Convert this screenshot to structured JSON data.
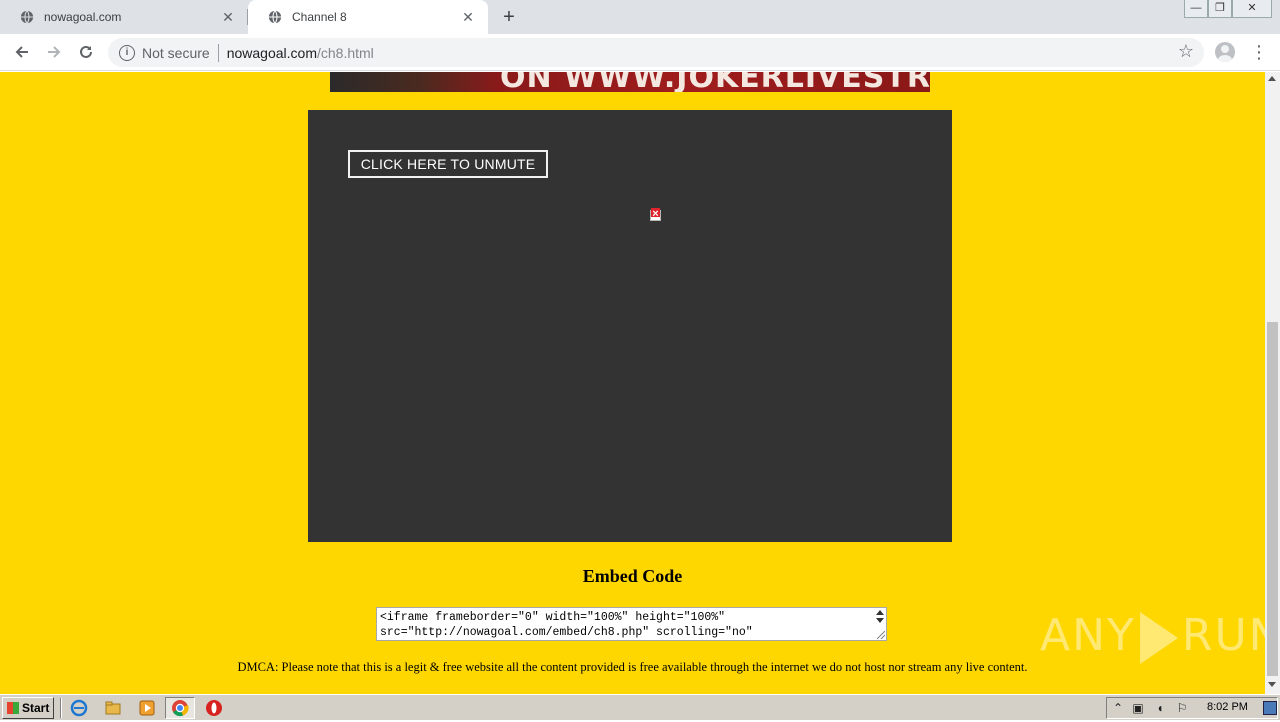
{
  "browser": {
    "tabs": [
      {
        "title": "nowagoal.com",
        "active": false
      },
      {
        "title": "Channel 8",
        "active": true
      }
    ],
    "new_tab_label": "+",
    "close_glyph": "✕",
    "address": {
      "security_label": "Not secure",
      "host": "nowagoal.com",
      "path": "/ch8.html"
    },
    "window_controls": {
      "minimize": "—",
      "restore": "❐",
      "close": "✕"
    }
  },
  "page": {
    "banner_text": "ON WWW.JOKERLIVESTREAM.COM",
    "player": {
      "unmute_button_label": "CLICK HERE TO UNMUTE"
    },
    "embed": {
      "title": "Embed Code",
      "code": "<iframe frameborder=\"0\" width=\"100%\" height=\"100%\"\nsrc=\"http://nowagoal.com/embed/ch8.php\" scrolling=\"no\""
    },
    "dmca_text": "DMCA: Please note that this is a legit & free website all the content provided is free available through the internet we do not host nor stream any live content."
  },
  "watermark": {
    "left": "ANY",
    "right": "RUN"
  },
  "taskbar": {
    "start_label": "Start",
    "clock": "8:02 PM"
  },
  "colors": {
    "page_background": "#ffd700",
    "player_background": "#333333",
    "banner_red": "#a01c1c"
  }
}
